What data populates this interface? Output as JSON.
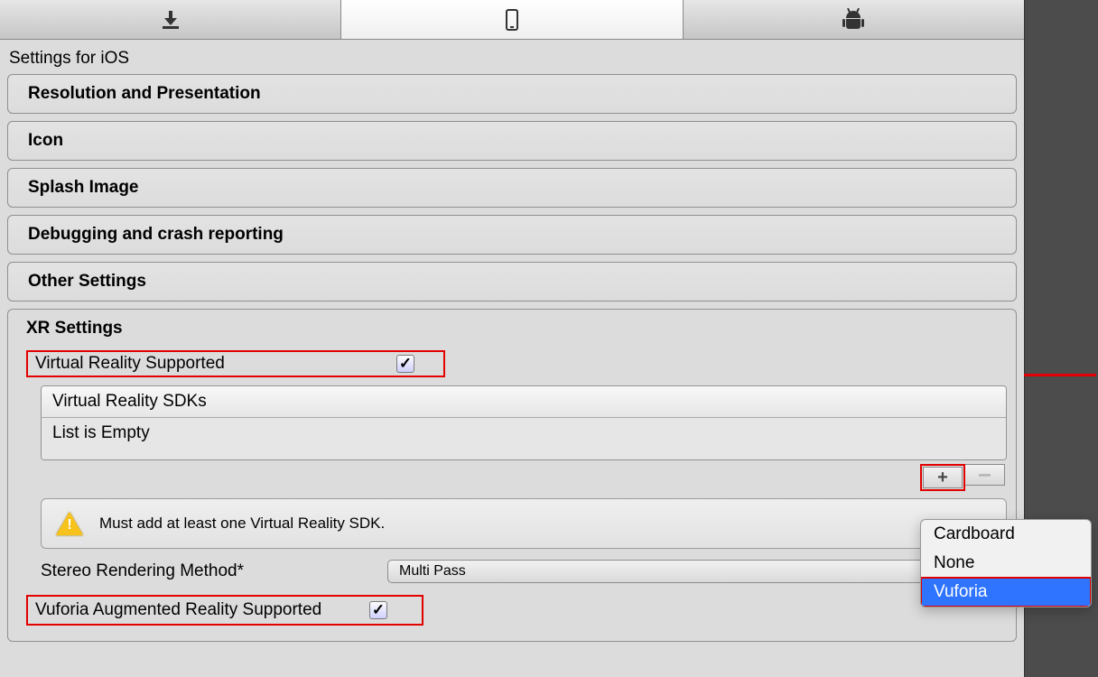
{
  "tabs": {
    "download": "download",
    "phone": "phone",
    "android": "android",
    "active_index": 1
  },
  "title": "Settings for iOS",
  "sections": {
    "resolution": "Resolution and Presentation",
    "icon": "Icon",
    "splash": "Splash Image",
    "debug": "Debugging and crash reporting",
    "other": "Other Settings"
  },
  "xr": {
    "header": "XR Settings",
    "vr_supported_label": "Virtual Reality Supported",
    "vr_supported_checked": "✓",
    "sdk_header": "Virtual Reality SDKs",
    "sdk_empty": "List is Empty",
    "plus": "+",
    "minus": "−",
    "warning": "Must add at least one Virtual Reality SDK.",
    "stereo_label": "Stereo Rendering Method*",
    "stereo_value": "Multi Pass",
    "vuforia_label": "Vuforia Augmented Reality Supported",
    "vuforia_checked": "✓"
  },
  "popup": {
    "items": [
      "Cardboard",
      "None",
      "Vuforia"
    ],
    "selected_index": 2
  }
}
